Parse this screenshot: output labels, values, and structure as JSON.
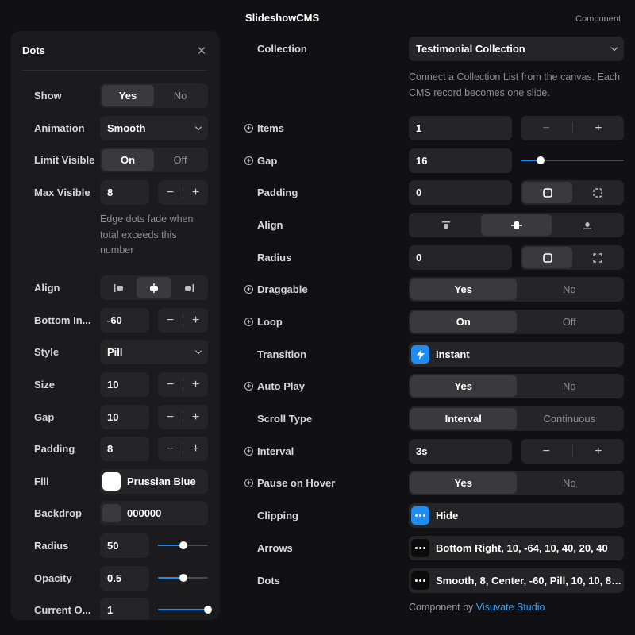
{
  "left": {
    "title": "Dots",
    "rows": {
      "show": {
        "label": "Show",
        "options": [
          "Yes",
          "No"
        ]
      },
      "animation": {
        "label": "Animation",
        "value": "Smooth"
      },
      "limit_visible": {
        "label": "Limit Visible",
        "options": [
          "On",
          "Off"
        ]
      },
      "max_visible": {
        "label": "Max Visible",
        "value": "8"
      },
      "max_visible_note": "Edge dots fade when total exceeds this number",
      "align": {
        "label": "Align"
      },
      "bottom_inset": {
        "label": "Bottom In...",
        "value": "-60"
      },
      "style": {
        "label": "Style",
        "value": "Pill"
      },
      "size": {
        "label": "Size",
        "value": "10"
      },
      "gap": {
        "label": "Gap",
        "value": "10"
      },
      "padding": {
        "label": "Padding",
        "value": "8"
      },
      "fill": {
        "label": "Fill",
        "value": "Prussian Blue",
        "color": "#ffffff"
      },
      "backdrop": {
        "label": "Backdrop",
        "value": "000000",
        "color": "#3a3a3e"
      },
      "radius": {
        "label": "Radius",
        "value": "50",
        "level": 0.5
      },
      "opacity": {
        "label": "Opacity",
        "value": "0.5",
        "level": 0.5
      },
      "current_opacity": {
        "label": "Current O...",
        "value": "1",
        "level": 1.0
      }
    }
  },
  "right": {
    "title": "SlideshowCMS",
    "badge": "Component",
    "collection": {
      "label": "Collection",
      "value": "Testimonial Collection"
    },
    "collection_note": "Connect a Collection List from the canvas. Each CMS record becomes one slide.",
    "items": {
      "label": "Items",
      "value": "1"
    },
    "gap": {
      "label": "Gap",
      "value": "16",
      "level": 0.19
    },
    "padding": {
      "label": "Padding",
      "value": "0"
    },
    "align": {
      "label": "Align"
    },
    "radius": {
      "label": "Radius",
      "value": "0"
    },
    "draggable": {
      "label": "Draggable",
      "options": [
        "Yes",
        "No"
      ]
    },
    "loop": {
      "label": "Loop",
      "options": [
        "On",
        "Off"
      ]
    },
    "transition": {
      "label": "Transition",
      "value": "Instant"
    },
    "auto_play": {
      "label": "Auto Play",
      "options": [
        "Yes",
        "No"
      ]
    },
    "scroll_type": {
      "label": "Scroll Type",
      "options": [
        "Interval",
        "Continuous"
      ]
    },
    "interval": {
      "label": "Interval",
      "value": "3s"
    },
    "pause_on_hover": {
      "label": "Pause on Hover",
      "options": [
        "Yes",
        "No"
      ]
    },
    "clipping": {
      "label": "Clipping",
      "value": "Hide"
    },
    "arrows": {
      "label": "Arrows",
      "value": "Bottom Right, 10, -64, 10, 40, 20, 40"
    },
    "dots": {
      "label": "Dots",
      "value": "Smooth, 8, Center, -60, Pill, 10, 10, 8, ..."
    },
    "footer_prefix": "Component by",
    "footer_link": "Visuvate Studio"
  },
  "colors": {
    "accent": "#1e8cf0",
    "panel": "#1b1b1d",
    "control": "#252528"
  }
}
